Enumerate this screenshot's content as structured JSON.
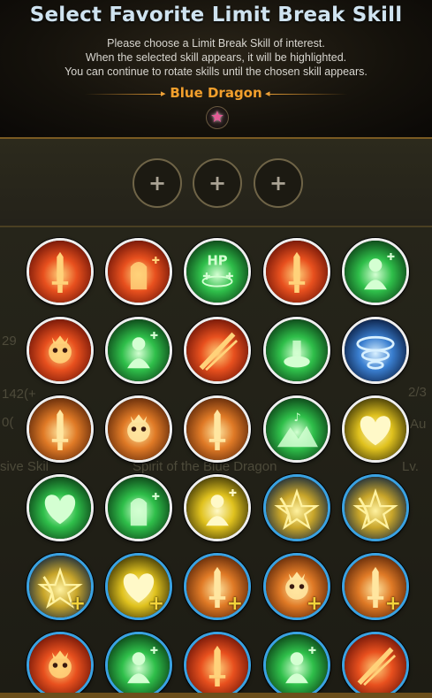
{
  "header": {
    "title": "Select Favorite Limit Break Skill",
    "desc_line1": "Please choose a Limit Break Skill of interest.",
    "desc_line2": "When the selected skill appears, it will be highlighted.",
    "desc_line3": "You can continue to rotate skills until the chosen skill appears.",
    "dragon_name": "Blue Dragon",
    "star_icon": "★"
  },
  "slots": [
    "+",
    "+",
    "+"
  ],
  "background_ghost": {
    "stat_a": "29",
    "stat_b": "142(+",
    "stat_c": "0(",
    "passive": "sive Skil",
    "spirit": "Spirit of the Blue Dragon",
    "level": "Lv.",
    "right_a": "2/3",
    "right_b": "Au"
  },
  "skills": [
    {
      "icon": "sword-shield-icon",
      "theme": "fire",
      "ring": "white",
      "plus": false
    },
    {
      "icon": "tombstone-sword-icon",
      "theme": "fire",
      "ring": "white",
      "plus": false
    },
    {
      "icon": "hp-heal-icon",
      "theme": "green",
      "ring": "white",
      "plus": false,
      "label": "HP"
    },
    {
      "icon": "flame-warrior-icon",
      "theme": "fire",
      "ring": "white",
      "plus": false
    },
    {
      "icon": "heal-figure-icon",
      "theme": "green",
      "ring": "white",
      "plus": false
    },
    {
      "icon": "skull-crowd-icon",
      "theme": "fire",
      "ring": "white",
      "plus": false
    },
    {
      "icon": "group-heal-icon",
      "theme": "green",
      "ring": "white",
      "plus": false
    },
    {
      "icon": "slash-icon",
      "theme": "fire",
      "ring": "white",
      "plus": false
    },
    {
      "icon": "potion-icon",
      "theme": "green",
      "ring": "white",
      "plus": false
    },
    {
      "icon": "whirlwind-sword-icon",
      "theme": "blue",
      "ring": "white",
      "plus": false
    },
    {
      "icon": "sword-burst-icon",
      "theme": "orange",
      "ring": "white",
      "plus": false
    },
    {
      "icon": "crowned-skull-icon",
      "theme": "orange",
      "ring": "white",
      "plus": false
    },
    {
      "icon": "sword-impact-icon",
      "theme": "orange",
      "ring": "white",
      "plus": false
    },
    {
      "icon": "song-pyramid-icon",
      "theme": "green",
      "ring": "white",
      "plus": false
    },
    {
      "icon": "heart-icon",
      "theme": "gold",
      "ring": "white",
      "plus": false
    },
    {
      "icon": "heart-tomb-icon",
      "theme": "green",
      "ring": "white",
      "plus": false
    },
    {
      "icon": "revive-tomb-icon",
      "theme": "green",
      "ring": "white",
      "plus": false
    },
    {
      "icon": "golden-figure-icon",
      "theme": "gold",
      "ring": "white",
      "plus": false
    },
    {
      "icon": "winged-star-icon",
      "theme": "goldblue",
      "ring": "blue",
      "plus": false
    },
    {
      "icon": "winged-pentagram-icon",
      "theme": "goldblue",
      "ring": "blue",
      "plus": false
    },
    {
      "icon": "winged-star-plus-icon",
      "theme": "goldblue",
      "ring": "blue",
      "plus": true
    },
    {
      "icon": "heart-plus-icon",
      "theme": "gold",
      "ring": "blue",
      "plus": true
    },
    {
      "icon": "sword-burst-plus-icon",
      "theme": "orange",
      "ring": "blue",
      "plus": true
    },
    {
      "icon": "crowned-skull-plus-icon",
      "theme": "orange",
      "ring": "blue",
      "plus": true
    },
    {
      "icon": "sword-impact-plus-icon",
      "theme": "orange",
      "ring": "blue",
      "plus": true
    },
    {
      "icon": "skull-crowd-plus-icon",
      "theme": "fire",
      "ring": "blue",
      "plus": false
    },
    {
      "icon": "group-heal-plus-icon",
      "theme": "green",
      "ring": "blue",
      "plus": false
    },
    {
      "icon": "flame-warrior-plus-icon",
      "theme": "fire",
      "ring": "blue",
      "plus": false
    },
    {
      "icon": "heal-figure-plus-icon",
      "theme": "green",
      "ring": "blue",
      "plus": false
    },
    {
      "icon": "slash-plus-icon",
      "theme": "fire",
      "ring": "blue",
      "plus": false
    }
  ],
  "colors": {
    "title": "#cfe3f0",
    "dragon_name": "#f29f2c",
    "white_ring": "#eeeeee",
    "blue_ring": "#3aa2e2",
    "plus": "#f3d33a"
  }
}
